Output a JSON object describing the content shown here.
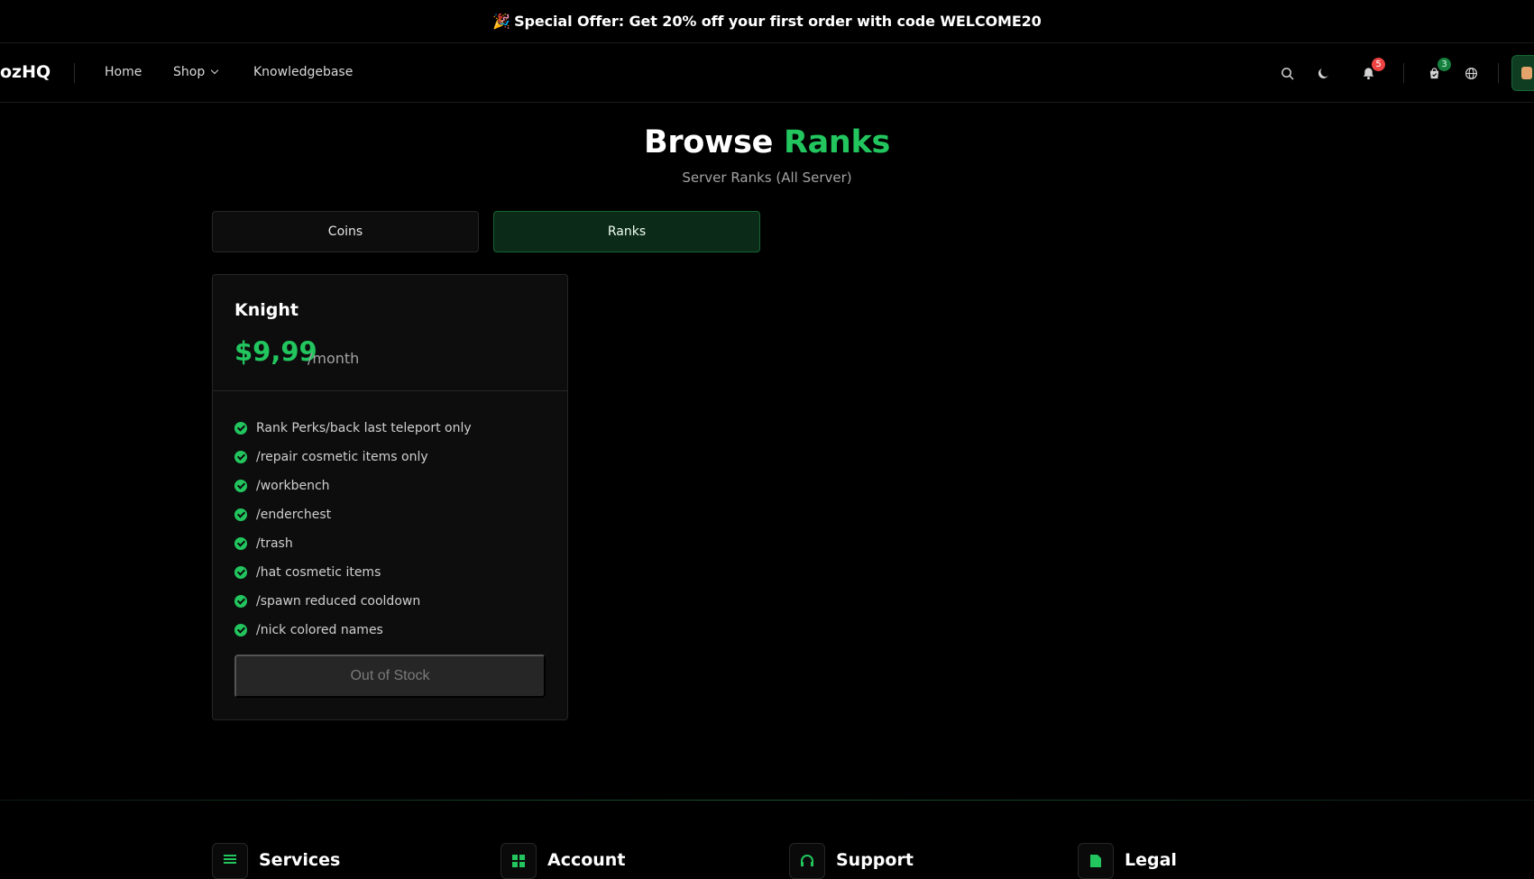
{
  "promo": {
    "icon": "party-popper-icon",
    "text": "Special Offer: Get 20% off your first order with code WELCOME20"
  },
  "nav": {
    "logo": "ozHQ",
    "links": [
      "Home",
      "Shop",
      "Knowledgebase"
    ],
    "notification_count": "5",
    "cart_count": "3"
  },
  "hero": {
    "title_main": "Browse",
    "title_accent": "Ranks",
    "subtitle": "Server Ranks (All Server)"
  },
  "tabs": [
    {
      "label": "Coins",
      "active": false
    },
    {
      "label": "Ranks",
      "active": true
    }
  ],
  "product": {
    "name": "Knight",
    "price": "$9,99",
    "period": "/month",
    "features": [
      "Rank Perks/back last teleport only",
      "/repair cosmetic items only",
      "/workbench",
      "/enderchest",
      "/trash",
      "/hat cosmetic items",
      "/spawn reduced cooldown",
      "/nick colored names"
    ],
    "button_label": "Out of Stock"
  },
  "footer": {
    "columns": [
      "Services",
      "Account",
      "Support",
      "Legal"
    ]
  },
  "colors": {
    "accent": "#22c55e",
    "background": "#000000",
    "card": "#0d0d0d",
    "badge_red": "#ef4444"
  }
}
